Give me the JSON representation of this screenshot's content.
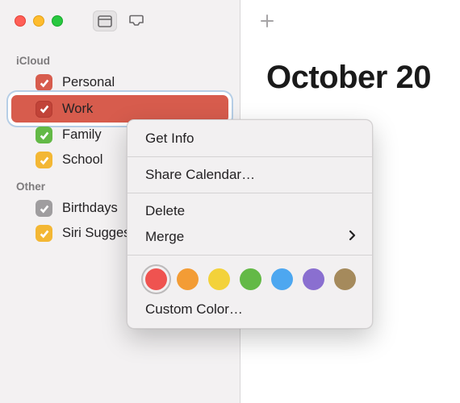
{
  "sidebar": {
    "sections": [
      {
        "title": "iCloud",
        "items": [
          {
            "label": "Personal",
            "color": "#d75c4d"
          },
          {
            "label": "Work",
            "color": "#d75c4d",
            "selected": true
          },
          {
            "label": "Family",
            "color": "#63b946"
          },
          {
            "label": "School",
            "color": "#f3b734"
          }
        ]
      },
      {
        "title": "Other",
        "items": [
          {
            "label": "Birthdays",
            "color": "#9f9d9f"
          },
          {
            "label": "Siri Suggestions",
            "color": "#f3b734"
          }
        ]
      }
    ]
  },
  "main": {
    "title": "October 20"
  },
  "context_menu": {
    "get_info": "Get Info",
    "share": "Share Calendar…",
    "delete": "Delete",
    "merge": "Merge",
    "custom_color": "Custom Color…",
    "swatches": [
      "#ef5350",
      "#f39c35",
      "#f3d23a",
      "#63b946",
      "#4da7f0",
      "#8a6fd0",
      "#a58a5c"
    ],
    "selected_swatch": 0
  }
}
